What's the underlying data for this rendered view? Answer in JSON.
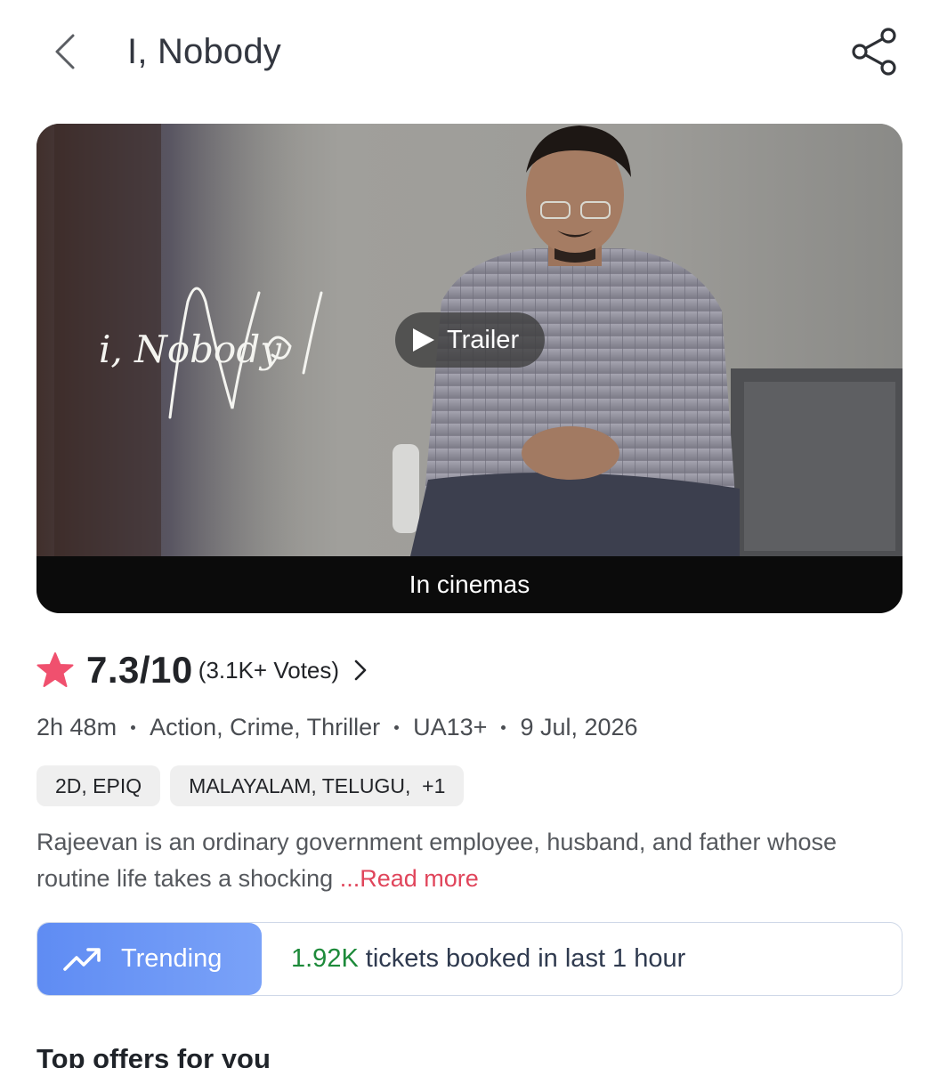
{
  "header": {
    "title": "I, Nobody",
    "back_icon": "chevron-left-icon",
    "share_icon": "share-icon"
  },
  "banner": {
    "poster_title": "i, Nobody",
    "trailer_label": "Trailer",
    "cinema_label": "In cinemas"
  },
  "rating": {
    "score": "7.3/10",
    "votes": "(3.1K+ Votes)",
    "star_color": "#f0506e"
  },
  "meta": {
    "duration": "2h 48m",
    "genres": "Action, Crime, Thriller",
    "certificate": "UA13+",
    "release_date": "9 Jul, 2026"
  },
  "chips": {
    "format": "2D, EPIQ",
    "languages": "MALAYALAM, TELUGU,  +1"
  },
  "description": {
    "text": "Rajeevan is an ordinary government employee, husband, and father whose routine life takes a shocking ",
    "read_more": "...Read more"
  },
  "trending": {
    "label": "Trending",
    "count": "1.92K",
    "text": "tickets booked in last 1 hour",
    "accent": "#6390f5",
    "count_color": "#1d8a3a"
  },
  "section": {
    "title": "Top offers for you"
  }
}
